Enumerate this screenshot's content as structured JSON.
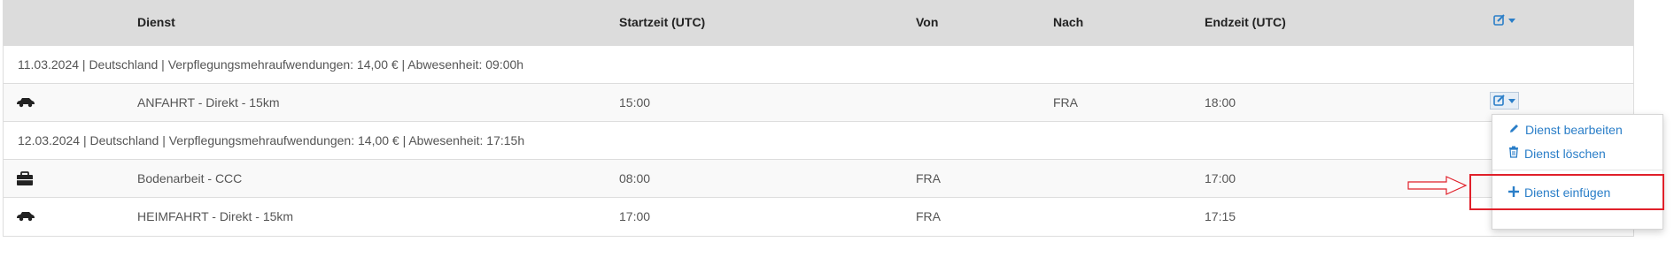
{
  "header": {
    "dienst": "Dienst",
    "startzeit": "Startzeit (UTC)",
    "von": "Von",
    "nach": "Nach",
    "endzeit": "Endzeit (UTC)",
    "actions_icon": "edit-dropdown-icon"
  },
  "groups": [
    {
      "summary": "11.03.2024 | Deutschland | Verpflegungsmehraufwendungen: 14,00 € | Abwesenheit: 09:00h",
      "rows": [
        {
          "icon": "car-icon",
          "dienst": "ANFAHRT - Direkt - 15km",
          "start": "15:00",
          "von": "",
          "nach": "FRA",
          "end": "18:00"
        }
      ]
    },
    {
      "summary": "12.03.2024 | Deutschland | Verpflegungsmehraufwendungen: 14,00 € | Abwesenheit: 17:15h",
      "rows": [
        {
          "icon": "briefcase-icon",
          "dienst": "Bodenarbeit - CCC",
          "start": "08:00",
          "von": "FRA",
          "nach": "",
          "end": "17:00"
        },
        {
          "icon": "car-icon",
          "dienst": "HEIMFAHRT - Direkt - 15km",
          "start": "17:00",
          "von": "FRA",
          "nach": "",
          "end": "17:15"
        }
      ]
    }
  ],
  "dropdown": {
    "edit_label": "Dienst bearbeiten",
    "delete_label": "Dienst löschen",
    "insert_label": "Dienst einfügen"
  },
  "colors": {
    "link": "#2a7ec8",
    "header_bg": "#dcdcdc",
    "highlight": "#e0202a"
  }
}
